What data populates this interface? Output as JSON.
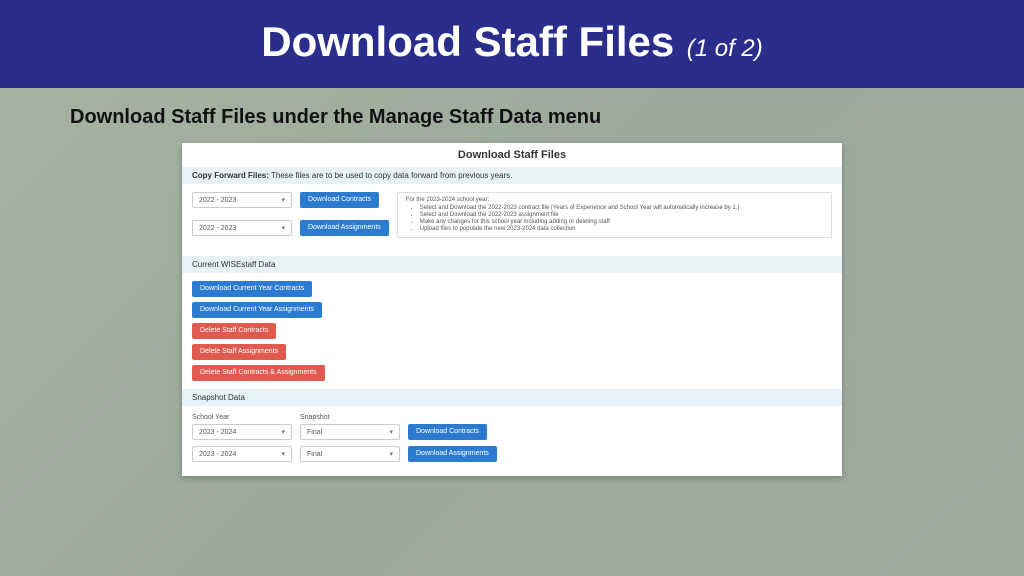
{
  "slide": {
    "title": "Download Staff Files",
    "progress": "(1 of 2)",
    "subhead": "Download Staff Files under the Manage Staff Data menu"
  },
  "panel": {
    "title": "Download Staff Files",
    "copyForward": {
      "label": "Copy Forward Files:",
      "note": "These files are to be used to copy data forward from previous years.",
      "year1": "2022 - 2023",
      "year2": "2022 - 2023",
      "btnContracts": "Download Contracts",
      "btnAssignments": "Download Assignments",
      "info": {
        "intro": "For the 2023-2024 school year:",
        "items": [
          "Select and Download the 2022-2023 contract file (Years of Experience and School Year will automatically increase by 1.)",
          "Select and Download the 2022-2023 assignment file",
          "Make any changes for this school year including adding or deleting staff",
          "Upload files to populate the new 2023-2024 data collection"
        ]
      }
    },
    "current": {
      "label": "Current WISEstaff Data",
      "btnCurContracts": "Download Current Year Contracts",
      "btnCurAssignments": "Download Current Year Assignments",
      "btnDelContracts": "Delete Staff Contracts",
      "btnDelAssignments": "Delete Staff Assignments",
      "btnDelBoth": "Delete Staff Contracts & Assignments"
    },
    "snapshot": {
      "label": "Snapshot Data",
      "colYear": "School Year",
      "colSnap": "Snapshot",
      "year1": "2023 - 2024",
      "snap1": "Final",
      "btn1": "Download Contracts",
      "year2": "2023 - 2024",
      "snap2": "Final",
      "btn2": "Download Assignments"
    }
  }
}
